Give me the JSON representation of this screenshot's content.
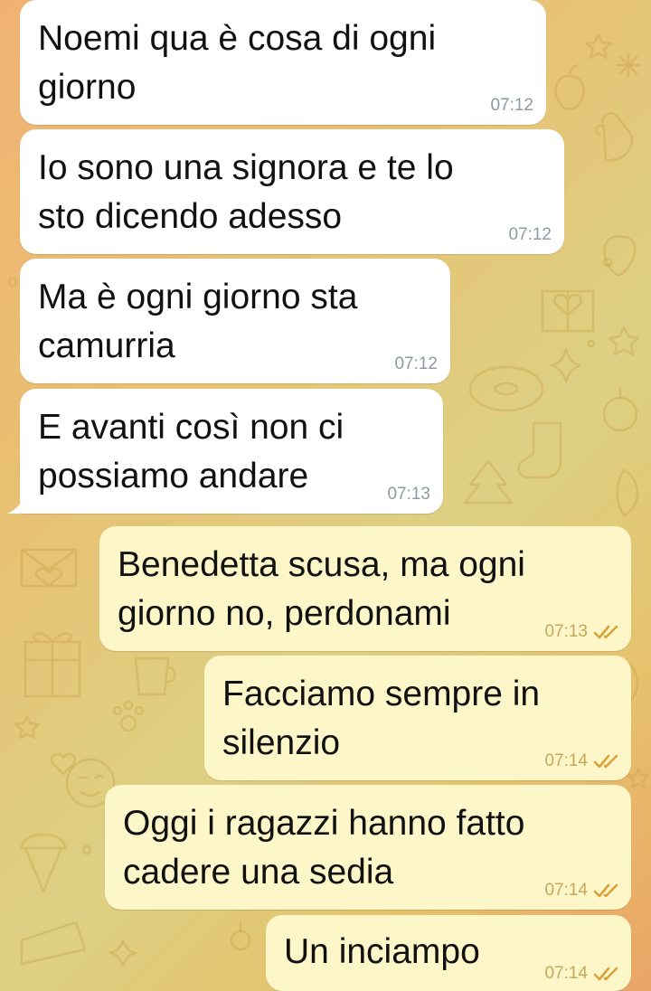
{
  "theme": {
    "incoming_bubble_color": "#ffffff",
    "outgoing_bubble_color": "#fdf6c9",
    "timestamp_incoming_color": "#8f9aa4",
    "timestamp_outgoing_color": "#c6a85c",
    "tick_color": "#d8a23a"
  },
  "messages": [
    {
      "direction": "incoming",
      "text": "Noemi qua è cosa di ogni\ngiorno",
      "time": "07:12"
    },
    {
      "direction": "incoming",
      "text": "Io sono una signora e te lo\nsto dicendo adesso",
      "time": "07:12"
    },
    {
      "direction": "incoming",
      "text": "Ma è ogni giorno sta\ncamurria",
      "time": "07:12"
    },
    {
      "direction": "incoming",
      "text": "E avanti così non ci\npossiamo andare",
      "time": "07:13"
    },
    {
      "direction": "outgoing",
      "text": "Benedetta scusa, ma ogni\ngiorno no, perdonami",
      "time": "07:13",
      "status_icon": "double-check-icon"
    },
    {
      "direction": "outgoing",
      "text": "Facciamo sempre in\nsilenzio",
      "time": "07:14",
      "status_icon": "double-check-icon"
    },
    {
      "direction": "outgoing",
      "text": "Oggi i ragazzi hanno fatto\ncadere una sedia",
      "time": "07:14",
      "status_icon": "double-check-icon"
    },
    {
      "direction": "outgoing",
      "text": "Un inciampo",
      "time": "07:14",
      "status_icon": "double-check-icon"
    }
  ]
}
